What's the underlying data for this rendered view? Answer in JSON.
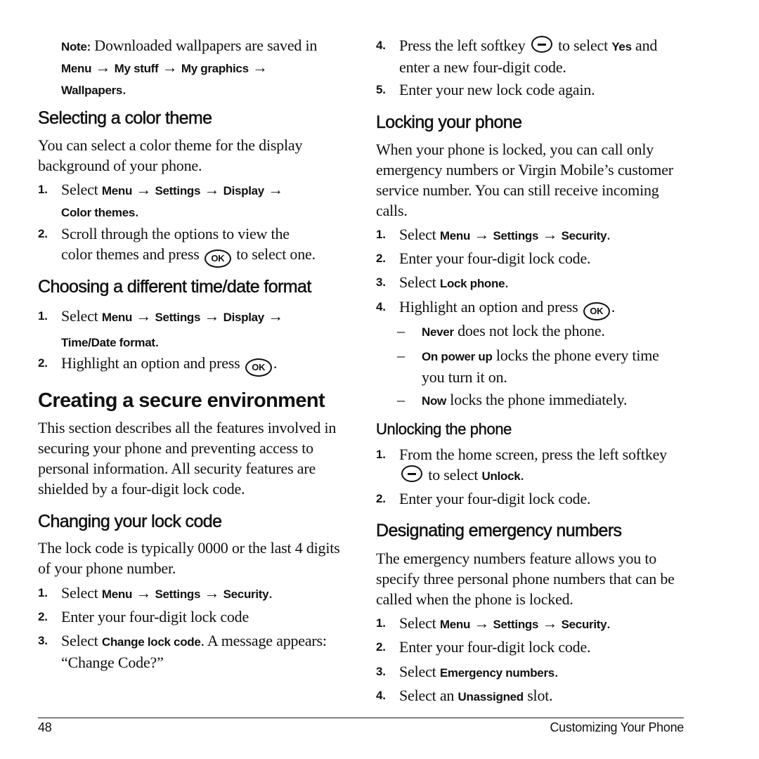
{
  "page": {
    "page_number": "48",
    "chapter_title": "Customizing Your Phone"
  },
  "note": {
    "label": "Note:",
    "text": " Downloaded wallpapers are saved in",
    "path": [
      "Menu",
      "My stuff",
      "My graphics",
      "Wallpapers"
    ],
    "arrow": "→"
  },
  "color_theme": {
    "heading": "Selecting a color theme",
    "intro": "You can select a color theme for the display background of your phone.",
    "steps": [
      {
        "num": "1.",
        "pre": "Select ",
        "path": [
          "Menu",
          "Settings",
          "Display",
          "Color themes"
        ]
      },
      {
        "num": "2.",
        "text_a": "Scroll through the options to view the",
        "text_b": "color themes and press",
        "text_c": " to select one."
      }
    ]
  },
  "time_date": {
    "heading": "Choosing a different time/date format",
    "steps": [
      {
        "num": "1.",
        "pre": "Select ",
        "path": [
          "Menu",
          "Settings",
          "Display",
          "Time/Date format"
        ]
      },
      {
        "num": "2.",
        "text_a": "Highlight an option and press",
        "text_b": "."
      }
    ]
  },
  "secure": {
    "heading": "Creating a secure environment",
    "intro": "This section describes all the features involved in securing your phone and preventing access to personal information. All security features are shielded by a four-digit lock code."
  },
  "change_code": {
    "heading": "Changing your lock code",
    "intro": "The lock code is typically 0000 or the last 4 digits of your phone number.",
    "steps": [
      {
        "num": "1.",
        "pre": "Select ",
        "path": [
          "Menu",
          "Settings",
          "Security"
        ]
      },
      {
        "num": "2.",
        "text": "Enter your four-digit lock code"
      },
      {
        "num": "3.",
        "pre": "Select ",
        "bold": "Change lock code",
        "post": ". A message appears: “Change Code?”"
      },
      {
        "num": "4.",
        "pre": "Press the left softkey",
        "mid": " to select ",
        "bold": "Yes",
        "post": " and enter a new four-digit code."
      },
      {
        "num": "5.",
        "text": "Enter your new lock code again."
      }
    ]
  },
  "locking": {
    "heading": "Locking your phone",
    "intro": "When your phone is locked, you can call only emergency numbers or Virgin Mobile’s customer service number. You can still receive incoming calls.",
    "steps": [
      {
        "num": "1.",
        "pre": "Select ",
        "path": [
          "Menu",
          "Settings",
          "Security"
        ]
      },
      {
        "num": "2.",
        "text": "Enter your four-digit lock code."
      },
      {
        "num": "3.",
        "pre": "Select ",
        "bold": "Lock phone",
        "post": "."
      },
      {
        "num": "4.",
        "text_a": "Highlight an option and press",
        "text_b": "."
      }
    ],
    "options": [
      {
        "dash": "–",
        "bold": "Never",
        "text": " does not lock the phone."
      },
      {
        "dash": "–",
        "bold": "On power up",
        "text": " locks the phone every time you turn it on."
      },
      {
        "dash": "–",
        "bold": "Now",
        "text": " locks the phone immediately."
      }
    ]
  },
  "unlocking": {
    "heading": "Unlocking the phone",
    "steps": [
      {
        "num": "1.",
        "text": "From the home screen, press the left softkey",
        "mid": " to select ",
        "bold": "Unlock",
        "post": "."
      },
      {
        "num": "2.",
        "text": "Enter your four-digit lock code."
      }
    ]
  },
  "emergency": {
    "heading": "Designating emergency numbers",
    "intro": "The emergency numbers feature allows you to specify three personal phone numbers that can be called when the phone is locked.",
    "steps": [
      {
        "num": "1.",
        "pre": "Select ",
        "path": [
          "Menu",
          "Settings",
          "Security"
        ]
      },
      {
        "num": "2.",
        "text": "Enter your four-digit lock code."
      },
      {
        "num": "3.",
        "pre": "Select ",
        "bold": "Emergency numbers",
        "post": "."
      },
      {
        "num": "4.",
        "pre": "Select an ",
        "bold": "Unassigned",
        "post": " slot."
      }
    ]
  },
  "icons": {
    "ok_key": "OK",
    "softkey": "left-softkey-icon"
  }
}
